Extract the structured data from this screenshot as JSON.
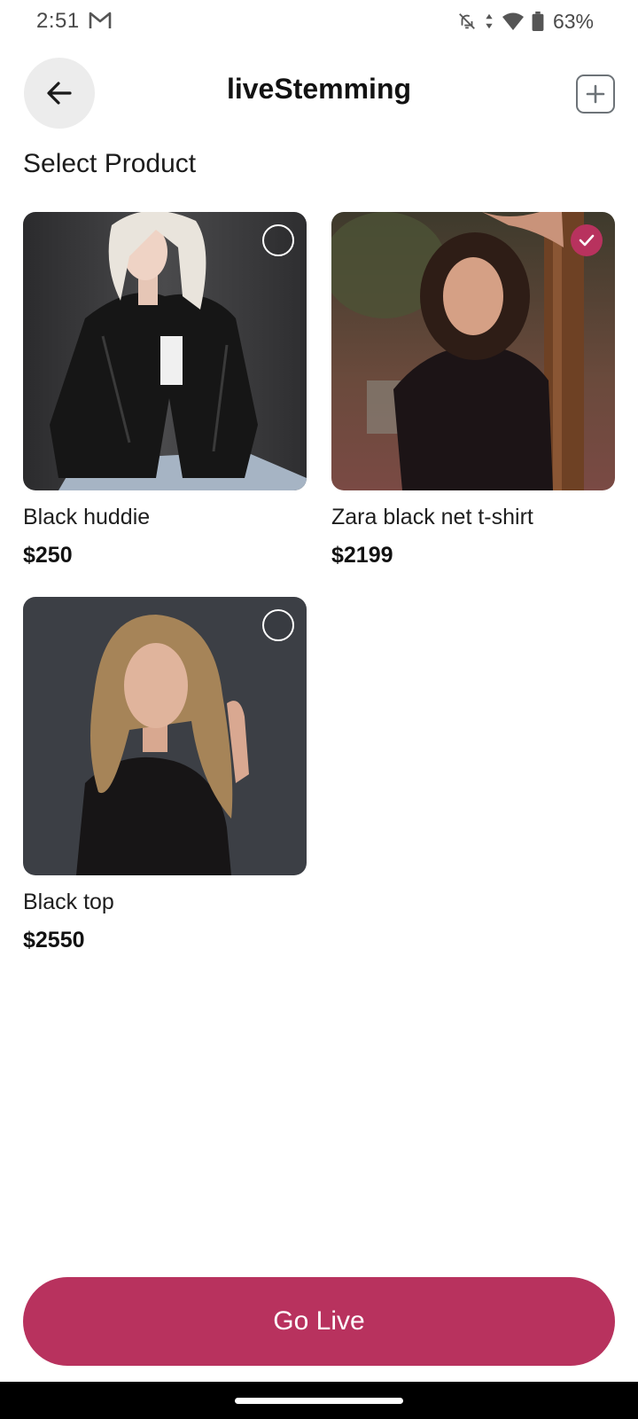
{
  "status_bar": {
    "time": "2:51",
    "battery": "63%",
    "icons": [
      "gmail-icon",
      "bell-off-icon",
      "data-arrows-icon",
      "wifi-icon",
      "battery-icon"
    ]
  },
  "header": {
    "title": "liveStemming",
    "back_icon": "arrow-left-icon",
    "add_icon": "plus-square-icon"
  },
  "section": {
    "title": "Select Product"
  },
  "products": [
    {
      "name": "Black huddie",
      "price": "$250",
      "selected": false
    },
    {
      "name": "Zara black net t-shirt",
      "price": "$2199",
      "selected": true
    },
    {
      "name": "Black top",
      "price": "$2550",
      "selected": false
    }
  ],
  "actions": {
    "go_live": "Go Live"
  },
  "colors": {
    "accent": "#b8325e",
    "back_button_bg": "#ececec",
    "nav_bar": "#000000"
  }
}
